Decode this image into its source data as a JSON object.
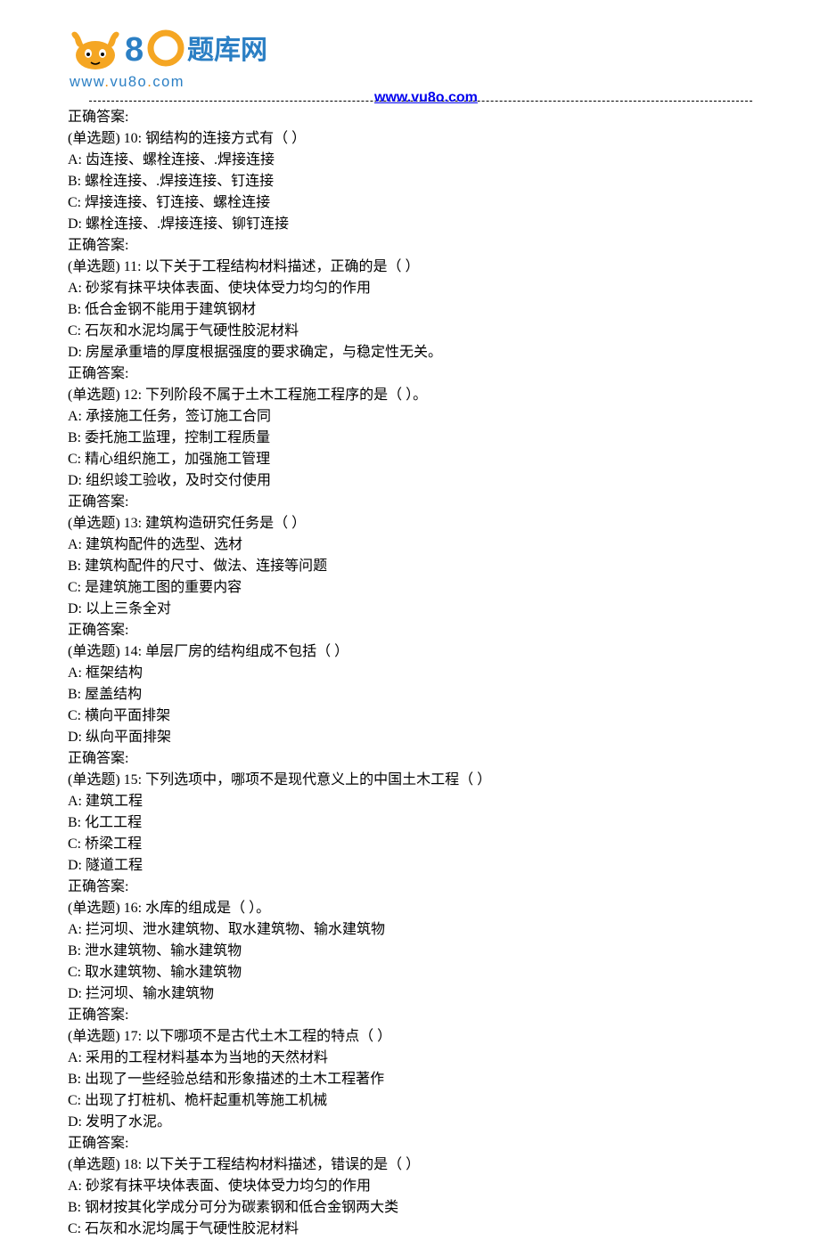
{
  "header": {
    "logo_text": "题库网",
    "logo_url_w": "www",
    "logo_url_v": "vu8o",
    "logo_url_c": "com",
    "link": "www.vu8o.com"
  },
  "intro_answer": "正确答案:",
  "questions": [
    {
      "prompt": "(单选题) 10: 钢结构的连接方式有（ ）",
      "options": [
        "A: 齿连接、螺栓连接、.焊接连接",
        "B: 螺栓连接、.焊接连接、钉连接",
        "C: 焊接连接、钉连接、螺栓连接",
        "D: 螺栓连接、.焊接连接、铆钉连接"
      ],
      "answer": "正确答案:"
    },
    {
      "prompt": "(单选题) 11: 以下关于工程结构材料描述，正确的是（ ）",
      "options": [
        "A: 砂浆有抹平块体表面、使块体受力均匀的作用",
        "B: 低合金钢不能用于建筑钢材",
        "C: 石灰和水泥均属于气硬性胶泥材料",
        "D: 房屋承重墙的厚度根据强度的要求确定，与稳定性无关。"
      ],
      "answer": "正确答案:"
    },
    {
      "prompt": "(单选题) 12: 下列阶段不属于土木工程施工程序的是（ ）。",
      "options": [
        "A: 承接施工任务，签订施工合同",
        "B: 委托施工监理，控制工程质量",
        "C: 精心组织施工，加强施工管理",
        "D: 组织竣工验收，及时交付使用"
      ],
      "answer": "正确答案:"
    },
    {
      "prompt": "(单选题) 13: 建筑构造研究任务是（ ）",
      "options": [
        "A: 建筑构配件的选型、选材",
        "B: 建筑构配件的尺寸、做法、连接等问题",
        "C: 是建筑施工图的重要内容",
        "D: 以上三条全对"
      ],
      "answer": "正确答案:"
    },
    {
      "prompt": "(单选题) 14: 单层厂房的结构组成不包括（ ）",
      "options": [
        "A: 框架结构",
        "B: 屋盖结构",
        "C: 横向平面排架",
        "D: 纵向平面排架"
      ],
      "answer": "正确答案:"
    },
    {
      "prompt": "(单选题) 15: 下列选项中，哪项不是现代意义上的中国土木工程（ ）",
      "options": [
        "A: 建筑工程",
        "B: 化工工程",
        "C: 桥梁工程",
        "D: 隧道工程"
      ],
      "answer": "正确答案:"
    },
    {
      "prompt": "(单选题) 16: 水库的组成是（ ）。",
      "options": [
        "A: 拦河坝、泄水建筑物、取水建筑物、输水建筑物",
        "B: 泄水建筑物、输水建筑物",
        "C: 取水建筑物、输水建筑物",
        "D: 拦河坝、输水建筑物"
      ],
      "answer": "正确答案:"
    },
    {
      "prompt": "(单选题) 17: 以下哪项不是古代土木工程的特点（ ）",
      "options": [
        "A: 采用的工程材料基本为当地的天然材料",
        "B: 出现了一些经验总结和形象描述的土木工程著作",
        "C: 出现了打桩机、桅杆起重机等施工机械",
        "D: 发明了水泥。"
      ],
      "answer": "正确答案:"
    },
    {
      "prompt": "(单选题) 18: 以下关于工程结构材料描述，错误的是（ ）",
      "options": [
        "A: 砂浆有抹平块体表面、使块体受力均匀的作用",
        "B: 钢材按其化学成分可分为碳素钢和低合金钢两大类",
        "C: 石灰和水泥均属于气硬性胶泥材料"
      ],
      "answer": ""
    }
  ]
}
